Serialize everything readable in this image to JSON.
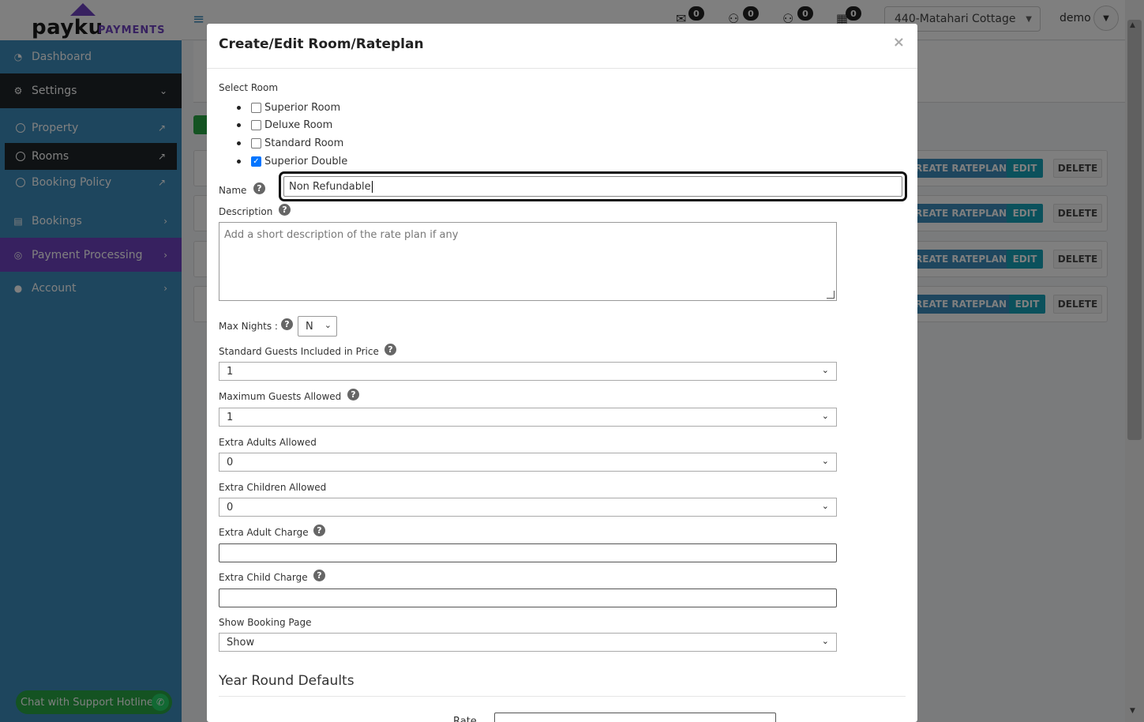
{
  "brand": {
    "logo_word": "payku",
    "logo_sub": "PAYMENTS"
  },
  "sidebar": {
    "items": [
      {
        "label": "Dashboard",
        "icon": "tachometer-icon"
      },
      {
        "label": "Settings",
        "icon": "gear-icon"
      },
      {
        "label": "Bookings",
        "icon": "list-icon"
      },
      {
        "label": "Payment Processing",
        "icon": "target-icon"
      },
      {
        "label": "Account",
        "icon": "user-icon"
      }
    ],
    "sub_items": [
      {
        "label": "Property"
      },
      {
        "label": "Rooms"
      },
      {
        "label": "Booking Policy"
      }
    ],
    "chat_label": "Chat with Support Hotline"
  },
  "topbar": {
    "badges": [
      "0",
      "0",
      "0",
      "0"
    ],
    "property": "440-Matahari Cottage",
    "user": "demo"
  },
  "page_rows": {
    "create_label": "REATE RATEPLAN",
    "create_label_last": "REATE RATEPLAN",
    "edit_label": "EDIT",
    "delete_label": "DELETE"
  },
  "modal": {
    "title": "Create/Edit Room/Rateplan",
    "close": "×",
    "select_room_label": "Select Room",
    "rooms": [
      {
        "label": "Superior Room",
        "checked": false
      },
      {
        "label": "Deluxe Room",
        "checked": false
      },
      {
        "label": "Standard Room",
        "checked": false
      },
      {
        "label": "Superior Double",
        "checked": true
      }
    ],
    "name_label": "Name",
    "name_value": "Non Refundable",
    "description_label": "Description",
    "description_placeholder": "Add a short description of the rate plan if any",
    "max_nights_label": "Max Nights :",
    "max_nights_value": "N",
    "standard_guests_label": "Standard Guests Included in Price",
    "standard_guests_value": "1",
    "max_guests_label": "Maximum Guests Allowed",
    "max_guests_value": "1",
    "extra_adults_label": "Extra Adults Allowed",
    "extra_adults_value": "0",
    "extra_children_label": "Extra Children Allowed",
    "extra_children_value": "0",
    "extra_adult_charge_label": "Extra Adult Charge",
    "extra_child_charge_label": "Extra Child Charge",
    "show_booking_label": "Show Booking Page",
    "show_booking_value": "Show",
    "section_title": "Year Round Defaults",
    "rate_label": "Rate"
  },
  "colors": {
    "sidebar": "#3c8dbc",
    "accent": "#17a2b8",
    "brand": "#6f42c1"
  }
}
